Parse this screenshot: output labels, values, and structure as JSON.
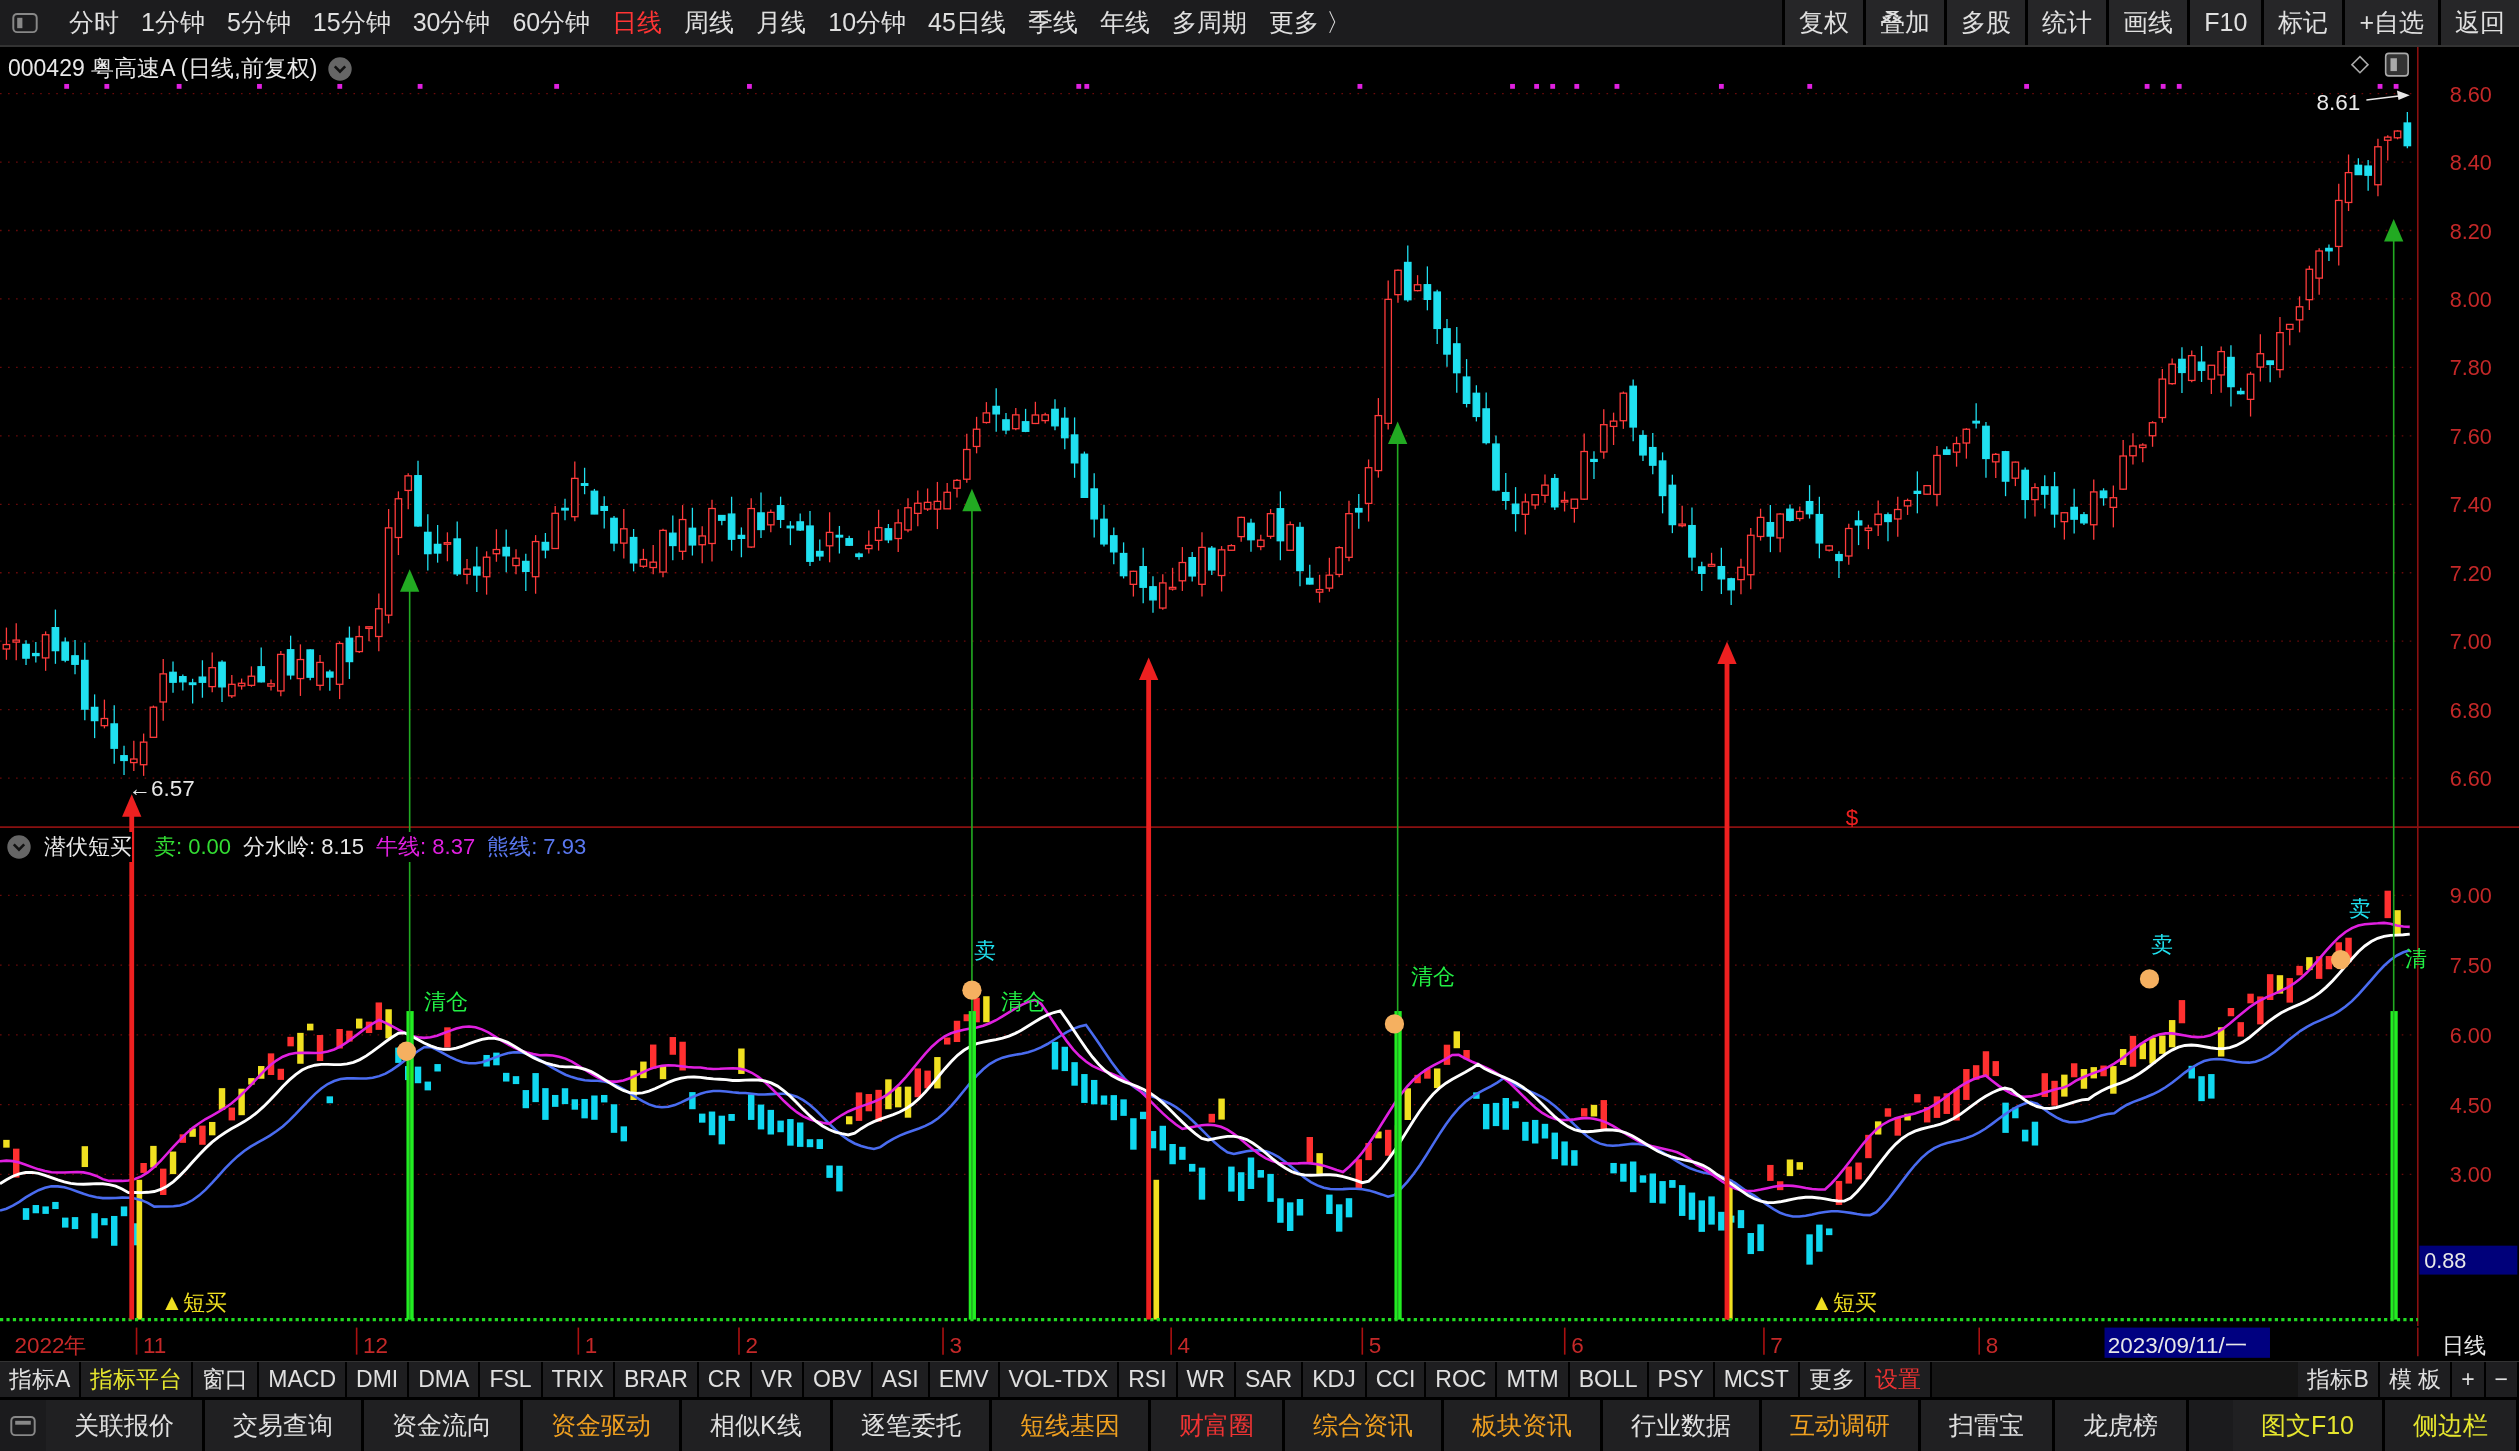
{
  "toolbar": {
    "periods": [
      {
        "label": "分时",
        "selected": false
      },
      {
        "label": "1分钟",
        "selected": false
      },
      {
        "label": "5分钟",
        "selected": false
      },
      {
        "label": "15分钟",
        "selected": false
      },
      {
        "label": "30分钟",
        "selected": false
      },
      {
        "label": "60分钟",
        "selected": false
      },
      {
        "label": "日线",
        "selected": true
      },
      {
        "label": "周线",
        "selected": false
      },
      {
        "label": "月线",
        "selected": false
      },
      {
        "label": "10分钟",
        "selected": false
      },
      {
        "label": "45日线",
        "selected": false
      },
      {
        "label": "季线",
        "selected": false
      },
      {
        "label": "年线",
        "selected": false
      },
      {
        "label": "多周期",
        "selected": false
      },
      {
        "label": "更多 〉",
        "selected": false
      }
    ],
    "buttons": [
      "复权",
      "叠加",
      "多股",
      "统计",
      "画线",
      "F10",
      "标记",
      "+自选",
      "返回"
    ]
  },
  "stock_title": "000429 粤高速A (日线,前复权)",
  "price_chart": {
    "axis_labels": [
      "8.60",
      "8.40",
      "8.20",
      "8.00",
      "7.80",
      "7.60",
      "7.40",
      "7.20",
      "7.00",
      "6.80",
      "6.60"
    ],
    "low_marker": "←6.57",
    "high_marker": "8.61",
    "marker_symbol": "$"
  },
  "indicator": {
    "name": "潜伏短买",
    "values": [
      {
        "text": "卖: 0.00",
        "kind": "sell"
      },
      {
        "text": "分水岭: 8.15",
        "kind": "divide"
      },
      {
        "text": "牛线: 8.37",
        "kind": "bull"
      },
      {
        "text": "熊线: 7.93",
        "kind": "bear"
      }
    ],
    "signals": [
      {
        "kind": "clear",
        "text": "清仓"
      },
      {
        "kind": "sell",
        "text": "卖"
      },
      {
        "kind": "clear",
        "text": "清仓"
      },
      {
        "kind": "clear",
        "text": "清仓"
      },
      {
        "kind": "sell",
        "text": "卖"
      },
      {
        "kind": "sell",
        "text": "卖"
      },
      {
        "kind": "clear",
        "text": "清"
      },
      {
        "kind": "buy",
        "text": "▲短买"
      },
      {
        "kind": "buy",
        "text": "▲短买"
      }
    ],
    "axis_labels": [
      "9.00",
      "7.50",
      "6.00",
      "4.50",
      "3.00"
    ],
    "current_value": "0.88"
  },
  "date_axis": {
    "labels": [
      "2022年",
      "11",
      "12",
      "1",
      "2",
      "3",
      "4",
      "5",
      "6",
      "7",
      "8"
    ],
    "cursor_date": "2023/09/11/一",
    "period": "日线"
  },
  "indicator_tabs": [
    {
      "label": "指标A",
      "kind": "plain"
    },
    {
      "label": "指标平台",
      "kind": "accent"
    },
    {
      "label": "窗口",
      "kind": "plain"
    },
    {
      "label": "MACD",
      "kind": "plain"
    },
    {
      "label": "DMI",
      "kind": "plain"
    },
    {
      "label": "DMA",
      "kind": "plain"
    },
    {
      "label": "FSL",
      "kind": "plain"
    },
    {
      "label": "TRIX",
      "kind": "plain"
    },
    {
      "label": "BRAR",
      "kind": "plain"
    },
    {
      "label": "CR",
      "kind": "plain"
    },
    {
      "label": "VR",
      "kind": "plain"
    },
    {
      "label": "OBV",
      "kind": "plain"
    },
    {
      "label": "ASI",
      "kind": "plain"
    },
    {
      "label": "EMV",
      "kind": "plain"
    },
    {
      "label": "VOL-TDX",
      "kind": "plain"
    },
    {
      "label": "RSI",
      "kind": "plain"
    },
    {
      "label": "WR",
      "kind": "plain"
    },
    {
      "label": "SAR",
      "kind": "plain"
    },
    {
      "label": "KDJ",
      "kind": "plain"
    },
    {
      "label": "CCI",
      "kind": "plain"
    },
    {
      "label": "ROC",
      "kind": "plain"
    },
    {
      "label": "MTM",
      "kind": "plain"
    },
    {
      "label": "BOLL",
      "kind": "plain"
    },
    {
      "label": "PSY",
      "kind": "plain"
    },
    {
      "label": "MCST",
      "kind": "plain"
    },
    {
      "label": "更多",
      "kind": "plain"
    },
    {
      "label": "设置",
      "kind": "alert"
    }
  ],
  "indicator_tabs_right": [
    "指标B",
    "模 板",
    "+",
    "−"
  ],
  "bottom_bar": [
    {
      "label": "关联报价",
      "kind": "plain"
    },
    {
      "label": "交易查询",
      "kind": "plain"
    },
    {
      "label": "资金流向",
      "kind": "plain"
    },
    {
      "label": "资金驱动",
      "kind": "orange"
    },
    {
      "label": "相似K线",
      "kind": "plain"
    },
    {
      "label": "逐笔委托",
      "kind": "plain"
    },
    {
      "label": "短线基因",
      "kind": "orange"
    },
    {
      "label": "财富圈",
      "kind": "alert"
    },
    {
      "label": "综合资讯",
      "kind": "orange"
    },
    {
      "label": "板块资讯",
      "kind": "orange"
    },
    {
      "label": "行业数据",
      "kind": "plain"
    },
    {
      "label": "互动调研",
      "kind": "orange"
    },
    {
      "label": "扫雷宝",
      "kind": "plain"
    },
    {
      "label": "龙虎榜",
      "kind": "plain"
    }
  ],
  "bottom_bar_right": [
    {
      "label": "图文F10",
      "kind": "accent"
    },
    {
      "label": "侧边栏",
      "kind": "accent"
    }
  ]
}
